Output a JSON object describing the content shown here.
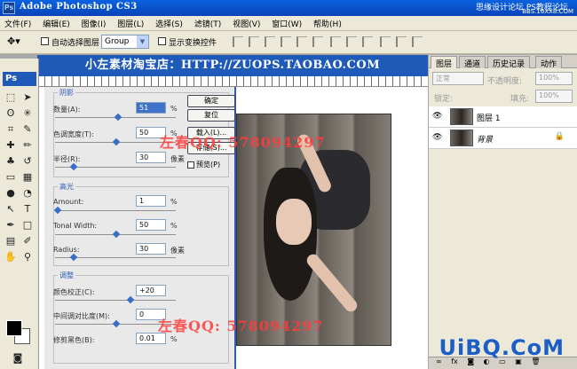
{
  "titlebar": {
    "app_icon": "Ps",
    "title": "Adobe Photoshop CS3",
    "watermark1": "思缘设计论坛",
    "watermark2": "BBS.16XX8.COM",
    "watermark_ps": "PS教程论坛"
  },
  "menu": [
    "文件(F)",
    "编辑(E)",
    "图像(I)",
    "图层(L)",
    "选择(S)",
    "滤镜(T)",
    "视图(V)",
    "窗口(W)",
    "帮助(H)"
  ],
  "options": {
    "tool_icon": "move-icon",
    "auto_select": "自动选择图层",
    "group_value": "Group",
    "show_transform": "显示变换控件"
  },
  "banner": "小左素材淘宝店：HTTP://ZUOPS.TAOBAO.COM",
  "toolbox": {
    "label": "Ps"
  },
  "dialog": {
    "shadows": {
      "title": "阴影",
      "amount_label": "数量(A):",
      "amount": "51",
      "tonal_label": "色调宽度(T):",
      "tonal": "50",
      "radius_label": "半径(R):",
      "radius": "30"
    },
    "highlights": {
      "title": "高光",
      "amount_label": "Amount:",
      "amount": "1",
      "tonal_label": "Tonal Width:",
      "tonal": "50",
      "radius_label": "Radius:",
      "radius": "30"
    },
    "adjust": {
      "title": "调整",
      "color_label": "颜色校正(C):",
      "color": "+20",
      "midtone_label": "中间调对比度(M):",
      "midtone": "0",
      "black_label": "修剪黑色(B):",
      "black": "0.01"
    },
    "units": {
      "pct": "%",
      "px": "像素"
    },
    "buttons": {
      "ok": "确定",
      "reset": "复位",
      "load": "载入(L)...",
      "save": "存储(S)..."
    },
    "preview_label": "预览(P)"
  },
  "watermarks": {
    "qq1": "左春QQ: 578094297",
    "qq2": "左春QQ: 578094297"
  },
  "layers_panel": {
    "tabs": [
      "图层",
      "通道",
      "历史记录",
      "动作"
    ],
    "blend_mode": "正常",
    "opacity_label": "不透明度:",
    "opacity": "100%",
    "lock_label": "锁定:",
    "fill_label": "填充:",
    "fill": "100%",
    "layers": [
      {
        "name": "图层 1"
      },
      {
        "name": "背景"
      }
    ],
    "bottom_icons": [
      "link-icon",
      "fx-icon",
      "mask-icon",
      "adjust-icon",
      "folder-icon",
      "new-layer-icon",
      "trash-icon"
    ]
  },
  "site_logo": "UiBQ.CoM"
}
